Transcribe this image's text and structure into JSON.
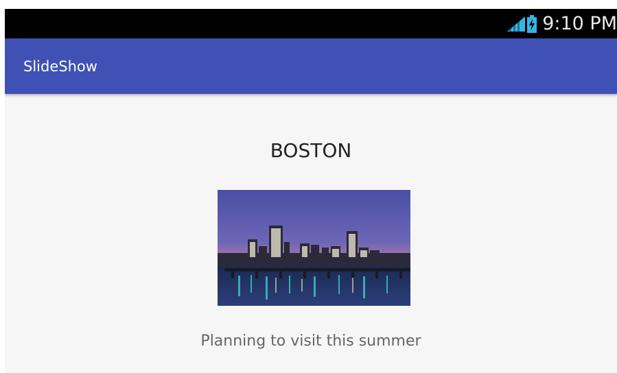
{
  "status_bar": {
    "time": "9:10 PM",
    "icons": [
      "signal-icon",
      "battery-charging-icon"
    ]
  },
  "app_bar": {
    "title": "SlideShow",
    "color": "#3f51b5"
  },
  "slide": {
    "title": "BOSTON",
    "image": "boston-skyline-night-image",
    "caption": "Planning to visit this summer"
  }
}
